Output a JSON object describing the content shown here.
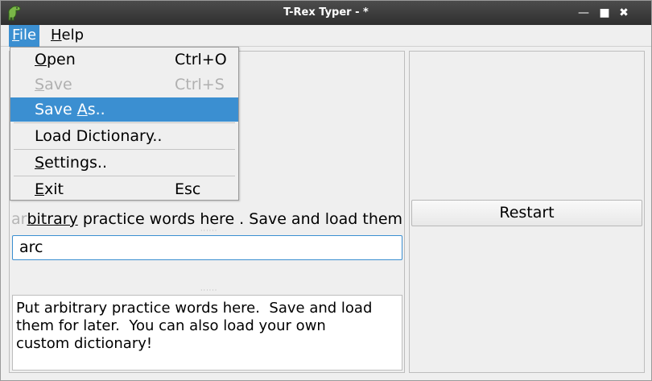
{
  "window": {
    "title": "T-Rex Typer - *",
    "controls": {
      "minimize": "—",
      "maximize": "■",
      "close": "✖"
    },
    "icon": "dinosaur-icon"
  },
  "menubar": {
    "file": {
      "label_ul": "F",
      "label_rest": "ile"
    },
    "help": {
      "label_ul": "H",
      "label_rest": "elp"
    }
  },
  "file_menu": {
    "open": {
      "ul": "O",
      "rest": "pen",
      "shortcut": "Ctrl+O"
    },
    "save": {
      "ul": "S",
      "rest": "ave",
      "shortcut": "Ctrl+S",
      "disabled": true
    },
    "save_as": {
      "pre": "Save ",
      "ul": "A",
      "rest": "s.."
    },
    "load_dictionary": {
      "label": "Load Dictionary.."
    },
    "settings": {
      "ul": "S",
      "rest": "ettings.."
    },
    "exit": {
      "ul": "E",
      "rest": "xit",
      "shortcut": "Esc"
    }
  },
  "practice": {
    "typed": "ar",
    "current": "bitrary",
    "remaining": " practice words here . Save and load them"
  },
  "input": {
    "value": "arc"
  },
  "words_text": "Put arbitrary practice words here.  Save and load\nthem for later.  You can also load your own\ncustom dictionary!",
  "restart": {
    "label": "Restart"
  },
  "colors": {
    "accent": "#3b8fd1",
    "title_bar": "#3a3a3a"
  }
}
